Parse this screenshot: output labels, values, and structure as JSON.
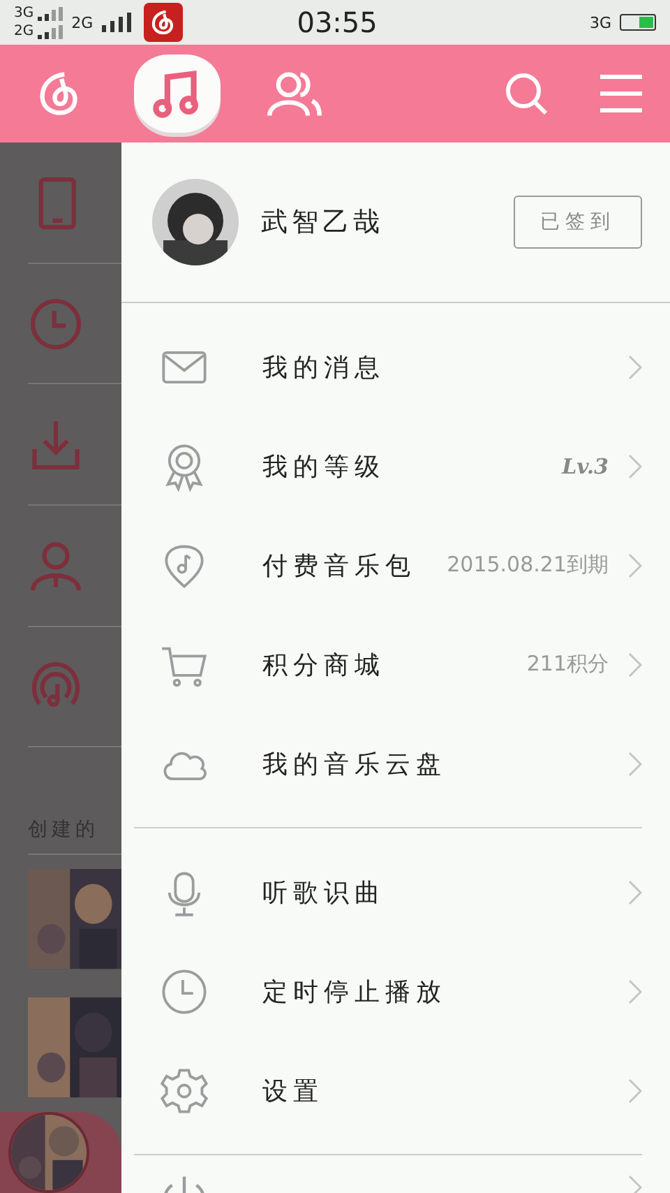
{
  "status_bar": {
    "sim1": "3G",
    "sim2": "2G",
    "network": "2G",
    "time": "03:55",
    "data": "3G"
  },
  "header": {
    "tabs": [
      {
        "kind": "logo",
        "selected": false
      },
      {
        "kind": "music",
        "selected": true
      },
      {
        "kind": "friends",
        "selected": false
      }
    ]
  },
  "background": {
    "rows": [
      {
        "kind": "phone"
      },
      {
        "kind": "clock"
      },
      {
        "kind": "download"
      },
      {
        "kind": "person"
      },
      {
        "kind": "radio"
      }
    ],
    "section_label": "创建的"
  },
  "drawer": {
    "profile": {
      "name": "武智乙哉",
      "checkin_button": "已签到"
    },
    "groups": [
      {
        "items": [
          {
            "kind": "mail",
            "label": "我的消息"
          },
          {
            "kind": "medal",
            "label": "我的等级",
            "value": "Lv.3",
            "emphasized": true
          },
          {
            "kind": "pick",
            "label": "付费音乐包",
            "value": "2015.08.21到期",
            "emphasized": false
          },
          {
            "kind": "cart",
            "label": "积分商城",
            "value": "211积分",
            "emphasized": false
          },
          {
            "kind": "cloud",
            "label": "我的音乐云盘"
          }
        ]
      },
      {
        "items": [
          {
            "kind": "mic",
            "label": "听歌识曲"
          },
          {
            "kind": "clock",
            "label": "定时停止播放"
          },
          {
            "kind": "gear",
            "label": "设置"
          }
        ]
      },
      {
        "items": [
          {
            "kind": "power"
          }
        ]
      }
    ]
  }
}
